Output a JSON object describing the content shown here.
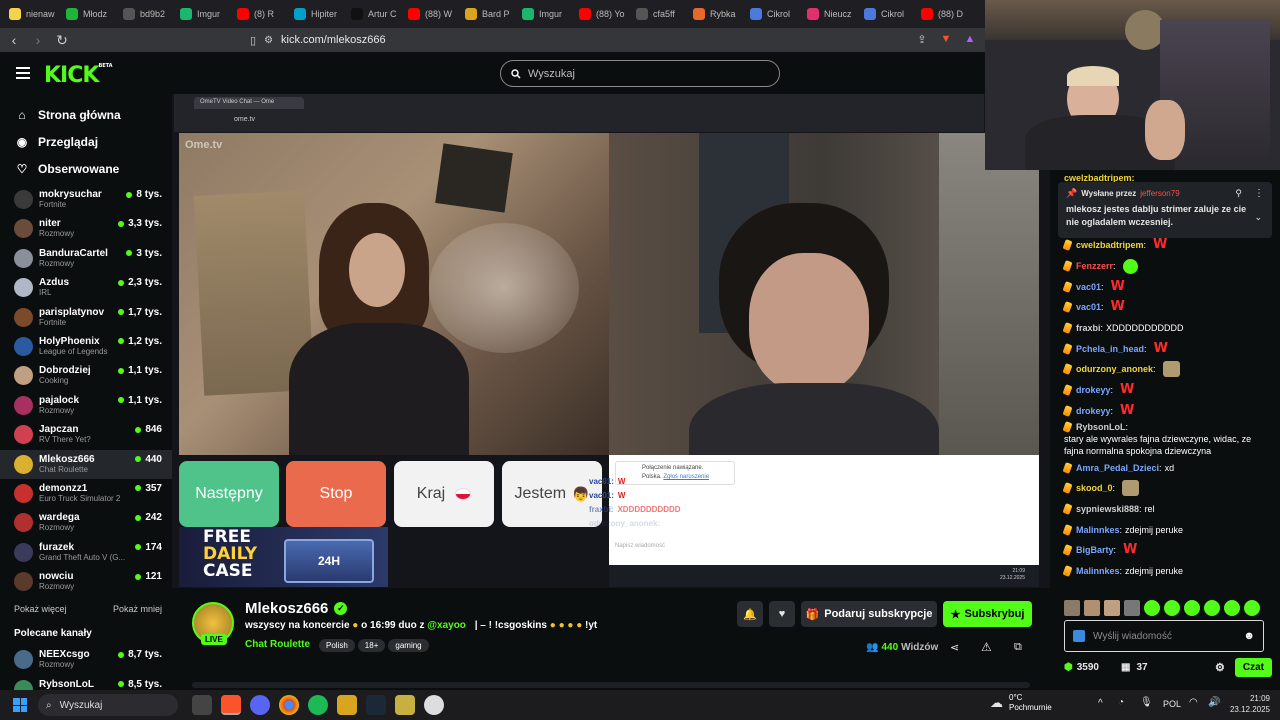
{
  "browser": {
    "tabs": [
      {
        "label": "nienaw",
        "color": "#f7d34a"
      },
      {
        "label": "Młodz",
        "color": "#1eb33a"
      },
      {
        "label": "bd9b2",
        "color": "#555555"
      },
      {
        "label": "Imgur",
        "color": "#1bb76e"
      },
      {
        "label": "(8) R",
        "color": "#ff0000"
      },
      {
        "label": "Hipiter",
        "color": "#00a0c8"
      },
      {
        "label": "Artur C",
        "color": "#111111"
      },
      {
        "label": "(88) W",
        "color": "#ff0000"
      },
      {
        "label": "Bard P",
        "color": "#d9a520"
      },
      {
        "label": "Imgur",
        "color": "#1bb76e"
      },
      {
        "label": "(88) Yo",
        "color": "#ff0000"
      },
      {
        "label": "cfa5ff",
        "color": "#555555"
      },
      {
        "label": "Rybka",
        "color": "#e6682a"
      },
      {
        "label": "Cikrol",
        "color": "#4a7adb"
      },
      {
        "label": "Nieucz",
        "color": "#e1306c"
      },
      {
        "label": "Cikrol",
        "color": "#4a7adb"
      },
      {
        "label": "(88) D",
        "color": "#ff0000"
      }
    ],
    "url": "kick.com/mlekosz666"
  },
  "header": {
    "logo": "KICK",
    "logo_beta": "BETA",
    "search_placeholder": "Wyszukaj"
  },
  "sidebar": {
    "nav": [
      {
        "label": "Strona główna",
        "icon": "home-icon"
      },
      {
        "label": "Przeglądaj",
        "icon": "compass-icon"
      },
      {
        "label": "Obserwowane",
        "icon": "heart-icon"
      }
    ],
    "channels": [
      {
        "name": "mokrysuchar",
        "category": "Fortnite",
        "viewers": "8 tys.",
        "color": "#3a3a3a"
      },
      {
        "name": "niter",
        "category": "Rozmowy",
        "viewers": "3,3 tys.",
        "color": "#6b4b3a"
      },
      {
        "name": "BanduraCartel",
        "category": "Rozmowy",
        "viewers": "3 tys.",
        "color": "#8a8f99"
      },
      {
        "name": "Azdus",
        "category": "IRL",
        "viewers": "2,3 tys.",
        "color": "#b0b8c8"
      },
      {
        "name": "parisplatynov",
        "category": "Fortnite",
        "viewers": "1,7 tys.",
        "color": "#7a4a2a"
      },
      {
        "name": "HolyPhoenix",
        "category": "League of Legends",
        "viewers": "1,2 tys.",
        "color": "#2a5aa0"
      },
      {
        "name": "Dobrodziej",
        "category": "Cooking",
        "viewers": "1,1 tys.",
        "color": "#c0a080"
      },
      {
        "name": "pajalock",
        "category": "Rozmowy",
        "viewers": "1,1 tys.",
        "color": "#a83060"
      },
      {
        "name": "Japczan",
        "category": "RV There Yet?",
        "viewers": "846",
        "color": "#d04050"
      },
      {
        "name": "Mlekosz666",
        "category": "Chat Roulette",
        "viewers": "440",
        "color": "#d9b030"
      },
      {
        "name": "demonzz1",
        "category": "Euro Truck Simulator 2",
        "viewers": "357",
        "color": "#c83030"
      },
      {
        "name": "wardega",
        "category": "Rozmowy",
        "viewers": "242",
        "color": "#b03030"
      },
      {
        "name": "furazek",
        "category": "Grand Theft Auto V (G...",
        "viewers": "174",
        "color": "#3a3a5a"
      },
      {
        "name": "nowciu",
        "category": "Rozmowy",
        "viewers": "121",
        "color": "#5a3a2a"
      }
    ],
    "show_more": "Pokaż więcej",
    "show_less": "Pokaż mniej",
    "recommended_title": "Polecane kanały",
    "recommended": [
      {
        "name": "NEEXcsgo",
        "category": "Rozmowy",
        "viewers": "8,7 tys.",
        "color": "#4a6a8a"
      },
      {
        "name": "RybsonLoL",
        "category": "",
        "viewers": "8,5 tys.",
        "color": "#3a8a5a"
      }
    ]
  },
  "video": {
    "inner_tab": "OmeTV Video Chat — Ome",
    "inner_url": "ome.tv",
    "watermark": "Ome.tv",
    "buttons": {
      "next": "Następny",
      "stop": "Stop",
      "country": "Kraj",
      "gender": "Jestem"
    },
    "ad": {
      "line1": "FREE",
      "line2": "DAILY",
      "line3": "CASE",
      "timer": "24H"
    },
    "inner_chat": {
      "status": "Połączenie nawiązane.",
      "country": "Polska.",
      "report": "Zgłoś naruszenie",
      "lines": [
        {
          "user": "vac01:",
          "text": "W"
        },
        {
          "user": "vac01:",
          "text": "W"
        },
        {
          "user": "fraxbi:",
          "text": "XDDDDDDDDDD"
        },
        {
          "user": "odurzony_anonek:",
          "text": ""
        }
      ],
      "placeholder": "Napisz wiadomość"
    },
    "inner_clock": {
      "time": "21:09",
      "date": "23.12.2025"
    }
  },
  "stream": {
    "name": "Mlekosz666",
    "title": "wszyscy na koncercie",
    "title_mid": "o 16:99 duo z",
    "mention": "@xayoo",
    "title_end": "| – ! !csgoskins",
    "title_yt": "!yt",
    "category": "Chat Roulette",
    "tags": [
      "Polish",
      "18+",
      "gaming"
    ],
    "live": "LIVE",
    "viewers": "440",
    "viewers_label": "Widzów",
    "gift": "Podaruj subskrypcje",
    "subscribe": "Subskrybuj"
  },
  "chat": {
    "pinned_by_label": "Wysłane przez",
    "pinned_by": "jefferson79",
    "pinned_text": "mlekosz jestes dablju strimer zaluje ze cie nie ogladalem wczesniej.",
    "top_partial": "cwelzbadtripem:",
    "messages": [
      {
        "user": "cwelzbadtripem",
        "text": "",
        "emote": "W",
        "color": "#f0d43a"
      },
      {
        "user": "Fenzzerr",
        "text": "",
        "emote": "pepe",
        "color": "#ff4d4d"
      },
      {
        "user": "vac01",
        "text": "",
        "emote": "W",
        "color": "#7aa7ff"
      },
      {
        "user": "vac01",
        "text": "",
        "emote": "W",
        "color": "#7aa7ff"
      },
      {
        "user": "fraxbi",
        "text": "XDDDDDDDDDDD",
        "emote": "",
        "color": "#cfcfcf"
      },
      {
        "user": "Pchela_in_head",
        "text": "",
        "emote": "W",
        "color": "#7aa7ff"
      },
      {
        "user": "odurzony_anonek",
        "text": "",
        "emote": "face",
        "color": "#f0d43a"
      },
      {
        "user": "drokeyy",
        "text": "",
        "emote": "W",
        "color": "#7aa7ff"
      },
      {
        "user": "drokeyy",
        "text": "",
        "emote": "W",
        "color": "#7aa7ff"
      },
      {
        "user": "RybsonLoL",
        "text": "stary ale wywrales fajna dziewczyne, widac, ze fajna normalna spokojna dziewczyna",
        "emote": "",
        "color": "#cfcfcf"
      },
      {
        "user": "Amra_Pedal_Dzieci",
        "text": "xd",
        "emote": "",
        "color": "#7aa7ff"
      },
      {
        "user": "skood_0",
        "text": "",
        "emote": "face",
        "color": "#f0d43a"
      },
      {
        "user": "sypniewski888",
        "text": "rel",
        "emote": "",
        "color": "#cfcfcf"
      },
      {
        "user": "Malinnkes",
        "text": "zdejmij peruke",
        "emote": "",
        "color": "#7aa7ff"
      },
      {
        "user": "BigBarty",
        "text": "",
        "emote": "W",
        "color": "#7aa7ff"
      },
      {
        "user": "Malinnkes",
        "text": "zdejmij peruke",
        "emote": "",
        "color": "#7aa7ff"
      }
    ],
    "input_placeholder": "Wyślij wiadomość",
    "points": "3590",
    "gifts": "37",
    "send": "Czat"
  },
  "taskbar": {
    "search": "Wyszukaj",
    "weather_temp": "0°C",
    "weather_desc": "Pochmurnie",
    "lang": "POL",
    "time": "21:09",
    "date": "23.12.2025"
  },
  "colors": {
    "accent": "#53fc18",
    "bg": "#0b0e0f"
  }
}
